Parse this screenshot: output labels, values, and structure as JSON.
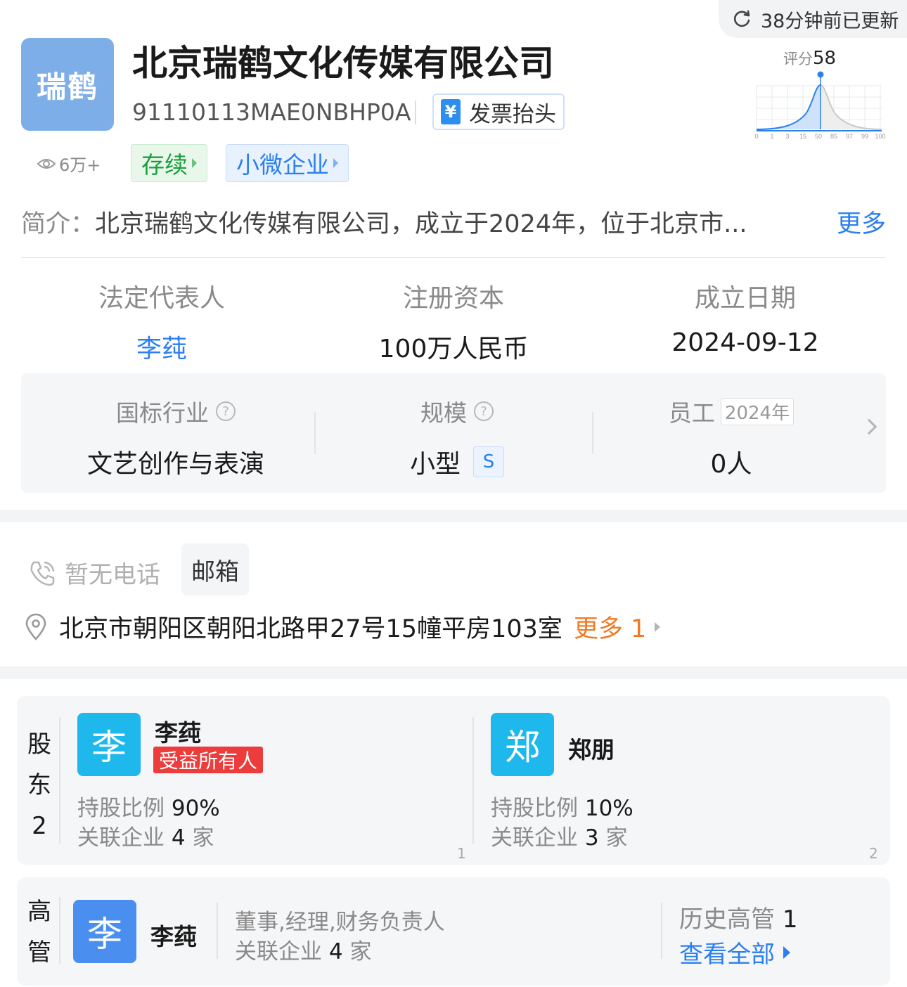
{
  "update": {
    "text": "38分钟前已更新",
    "icon": "refresh-icon"
  },
  "company": {
    "logo_text": "瑞鹤",
    "name": "北京瑞鹤文化传媒有限公司",
    "credit_code": "91110113MAE0NBHP0A",
    "invoice_label": "发票抬头",
    "invoice_icon_glyph": "¥",
    "views": "6万+",
    "tags": [
      "存续",
      "小微企业"
    ]
  },
  "score": {
    "label": "评分",
    "value": "58",
    "ticks": [
      "0",
      "1",
      "3",
      "15",
      "50",
      "85",
      "97",
      "99",
      "100"
    ]
  },
  "intro": {
    "label": "简介：",
    "text": "北京瑞鹤文化传媒有限公司，成立于2024年，位于北京市...",
    "more": "更多"
  },
  "facts": [
    {
      "label": "法定代表人",
      "value": "李莼"
    },
    {
      "label": "注册资本",
      "value": "100万人民币"
    },
    {
      "label": "成立日期",
      "value": "2024-09-12"
    }
  ],
  "industry": {
    "industry_label": "国标行业",
    "industry_value": "文艺创作与表演",
    "scale_label": "规模",
    "scale_value": "小型",
    "scale_badge": "S",
    "staff_label": "员工",
    "staff_year": "2024年",
    "staff_value": "0人",
    "help_glyph": "?"
  },
  "contact": {
    "phone": "暂无电话",
    "email": "邮箱",
    "address": "北京市朝阳区朝阳北路甲27号15幢平房103室",
    "address_more": "更多 1"
  },
  "shareholders": {
    "label_chars": [
      "股",
      "东",
      "2"
    ],
    "items": [
      {
        "avatar": "李",
        "name": "李莼",
        "tag": "受益所有人",
        "ratio_label": "持股比例",
        "ratio": "90%",
        "related_label": "关联企业",
        "related_count": "4",
        "related_unit": "家",
        "index": "1"
      },
      {
        "avatar": "郑",
        "name": "郑朋",
        "tag": "",
        "ratio_label": "持股比例",
        "ratio": "10%",
        "related_label": "关联企业",
        "related_count": "3",
        "related_unit": "家",
        "index": "2"
      }
    ]
  },
  "executives": {
    "label_chars": [
      "高",
      "管"
    ],
    "avatar": "李",
    "name": "李莼",
    "role": "董事,经理,财务负责人",
    "related_label": "关联企业",
    "related_count": "4",
    "related_unit": "家",
    "history_label": "历史高管",
    "history_count": "1",
    "view_all": "查看全部"
  },
  "colors": {
    "accent": "#2b7ff0",
    "orange": "#f07a22",
    "red_tag": "#ec3c3c",
    "green": "#1a9e3c"
  }
}
